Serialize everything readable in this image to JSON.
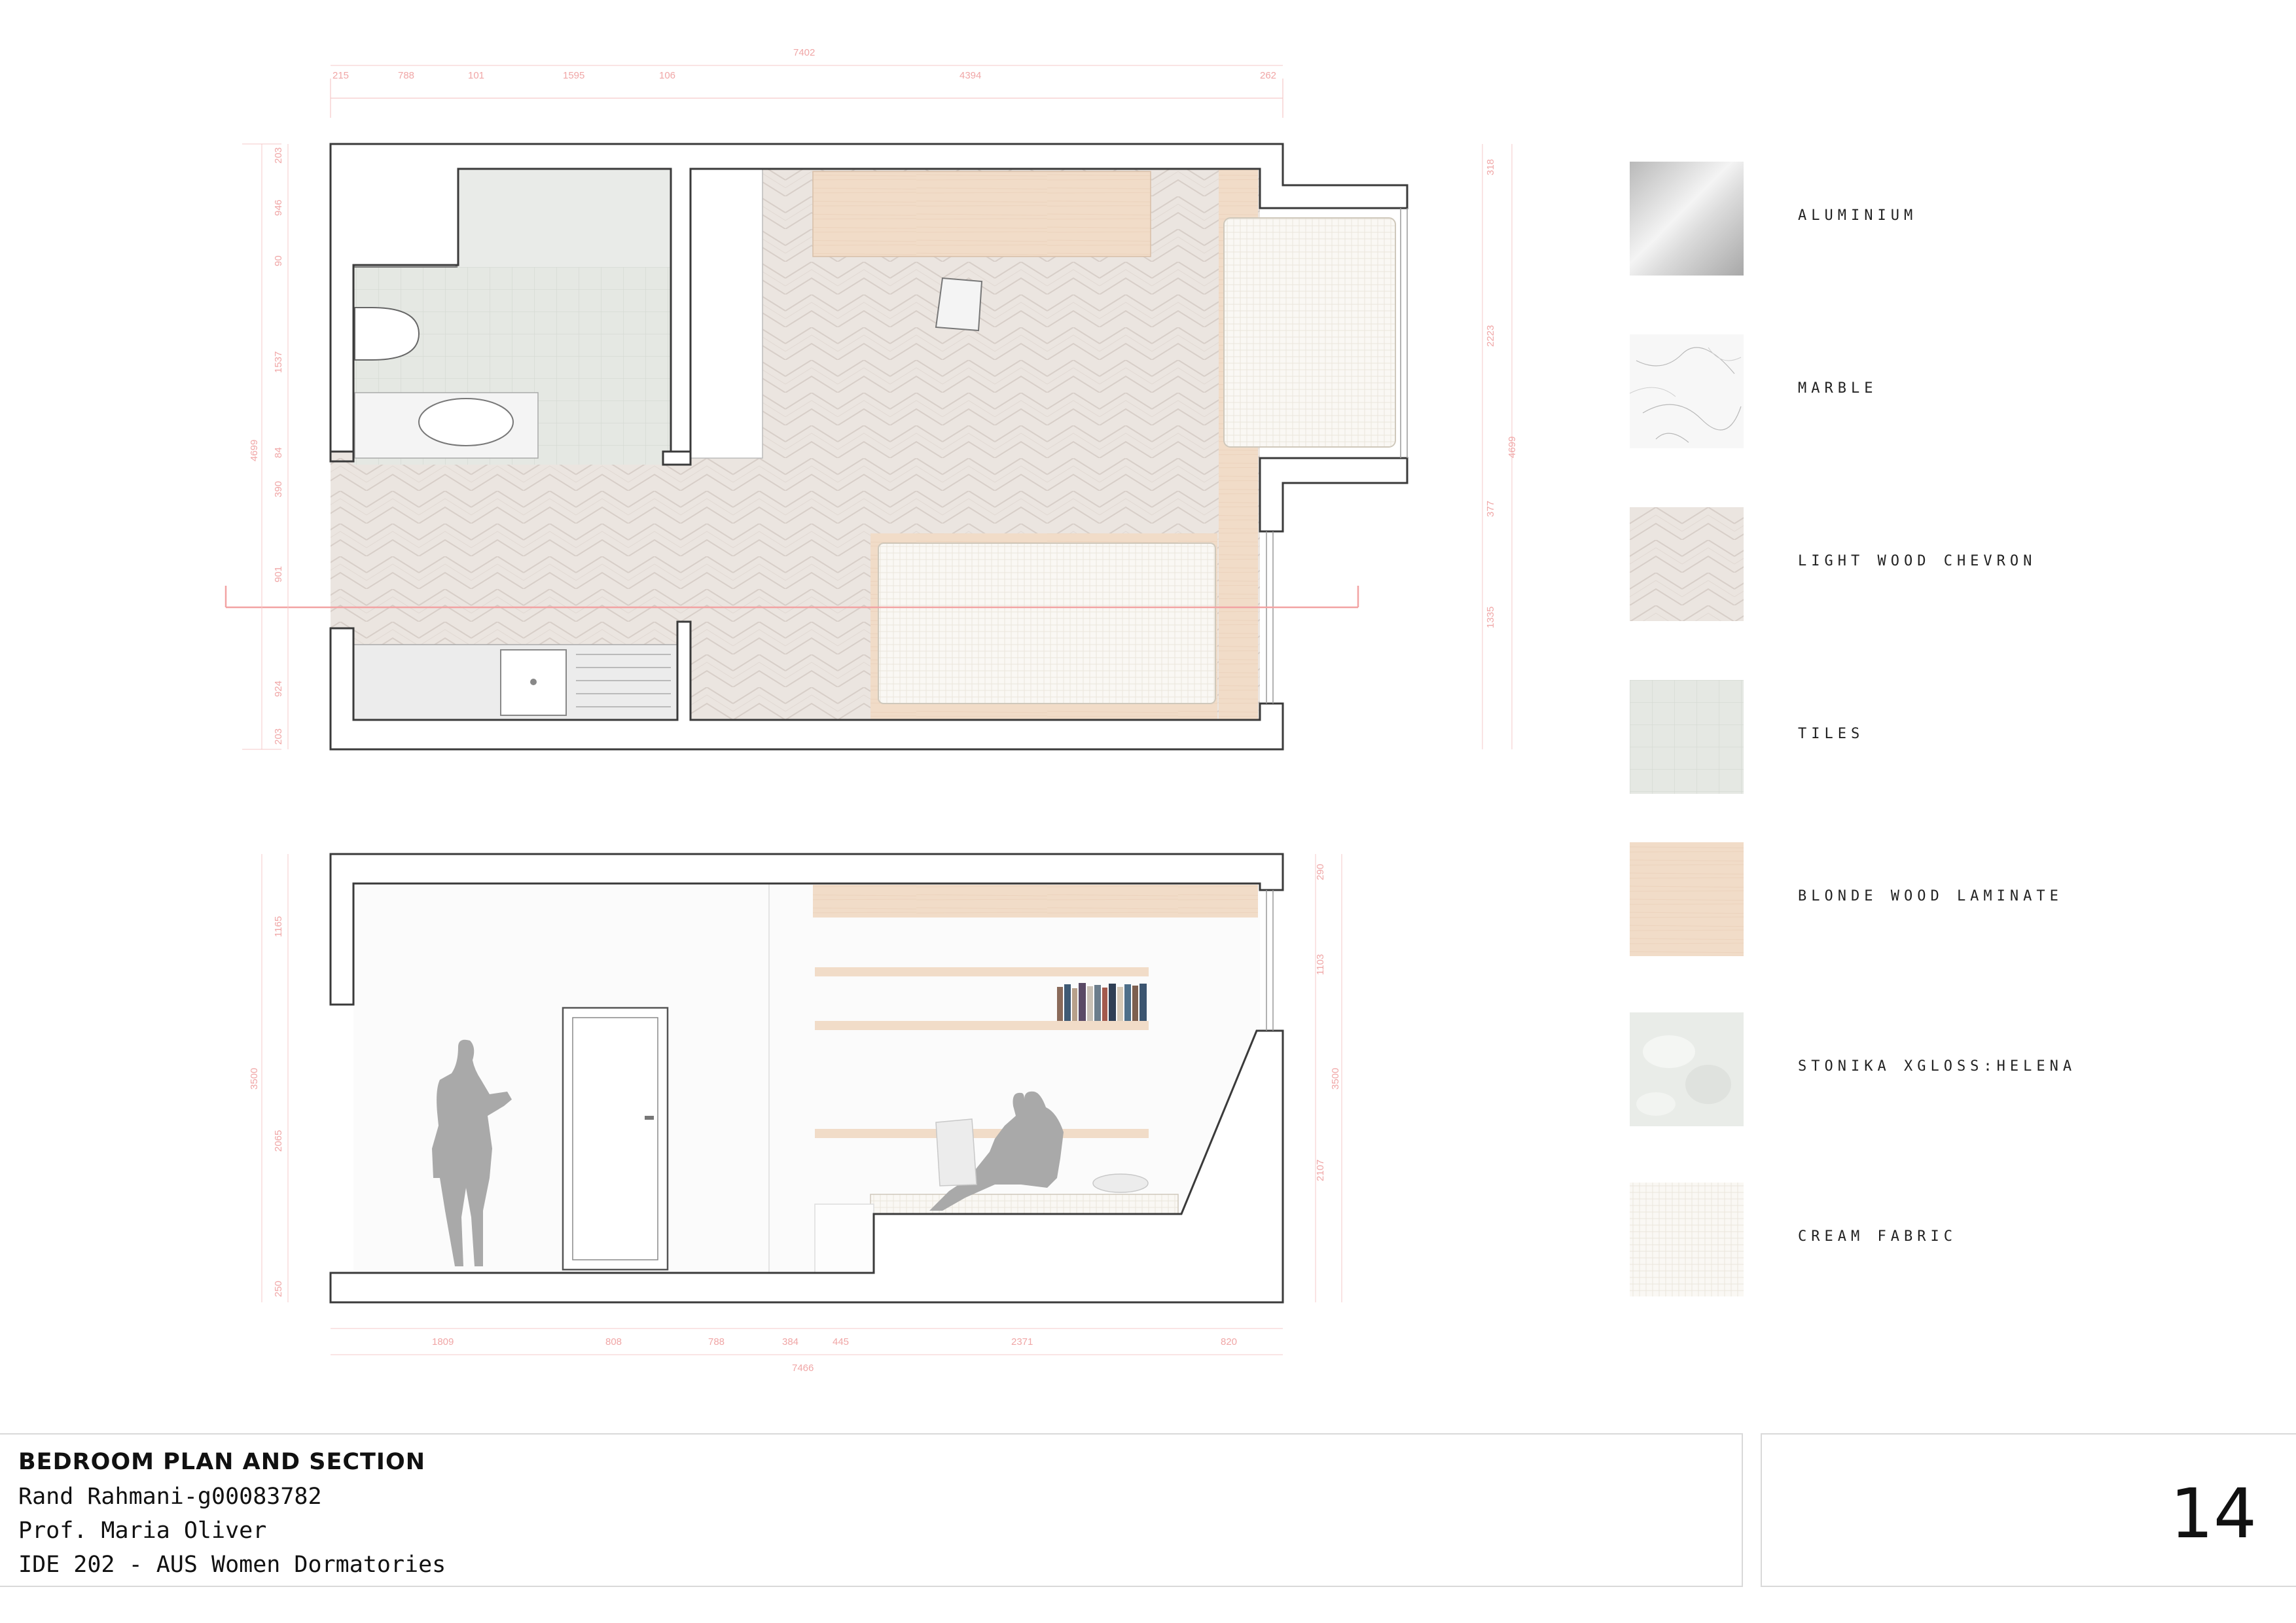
{
  "plan_dimensions": {
    "top": [
      "215",
      "788",
      "101",
      "1595",
      "106",
      "4394",
      "262"
    ],
    "top_total": "7402",
    "left": [
      "203",
      "946",
      "90",
      "1537",
      "84",
      "390",
      "901",
      "924",
      "203"
    ],
    "left_total": "4699",
    "right": [
      "318",
      "2223",
      "377",
      "1335"
    ],
    "right_total": "4699"
  },
  "section_dimensions": {
    "left": [
      "1165",
      "2065",
      "250"
    ],
    "left_total": "3500",
    "right": [
      "290",
      "1103",
      "2107"
    ],
    "right_total": "3500",
    "bottom": [
      "1809",
      "808",
      "788",
      "384",
      "445",
      "2371",
      "820"
    ],
    "bottom_total": "7466"
  },
  "legend": [
    {
      "label": "ALUMINIUM",
      "texture": "aluminium",
      "color": "#cfcfcf"
    },
    {
      "label": "MARBLE",
      "texture": "marble",
      "color": "#f6f6f6"
    },
    {
      "label": "LIGHT WOOD CHEVRON",
      "texture": "chevron",
      "color": "#e4dcd6"
    },
    {
      "label": "TILES",
      "texture": "tiles",
      "color": "#e3e6e1"
    },
    {
      "label": "BLONDE WOOD LAMINATE",
      "texture": "laminate",
      "color": "#f1dcc8"
    },
    {
      "label": "STONIKA XGLOSS:HELENA",
      "texture": "stonika",
      "color": "#e8ebe7"
    },
    {
      "label": "CREAM FABRIC",
      "texture": "fabric",
      "color": "#f7f3ea"
    }
  ],
  "title_block": {
    "title": "BEDROOM PLAN AND SECTION",
    "student": "Rand Rahmani-g00083782",
    "professor": "Prof. Maria Oliver",
    "course": "IDE 202 - AUS Women Dormatories",
    "page_number": "14"
  },
  "colors": {
    "wall": "#3a3a3a",
    "dimension": "#f0a6a6",
    "section_cut": "#f2a3a3",
    "chevron": "#e6dfda",
    "tiles": "#e4e7e2",
    "laminate": "#f1dcc8",
    "fabric": "#f8f6f1",
    "silhouette": "#a9a9a9"
  }
}
